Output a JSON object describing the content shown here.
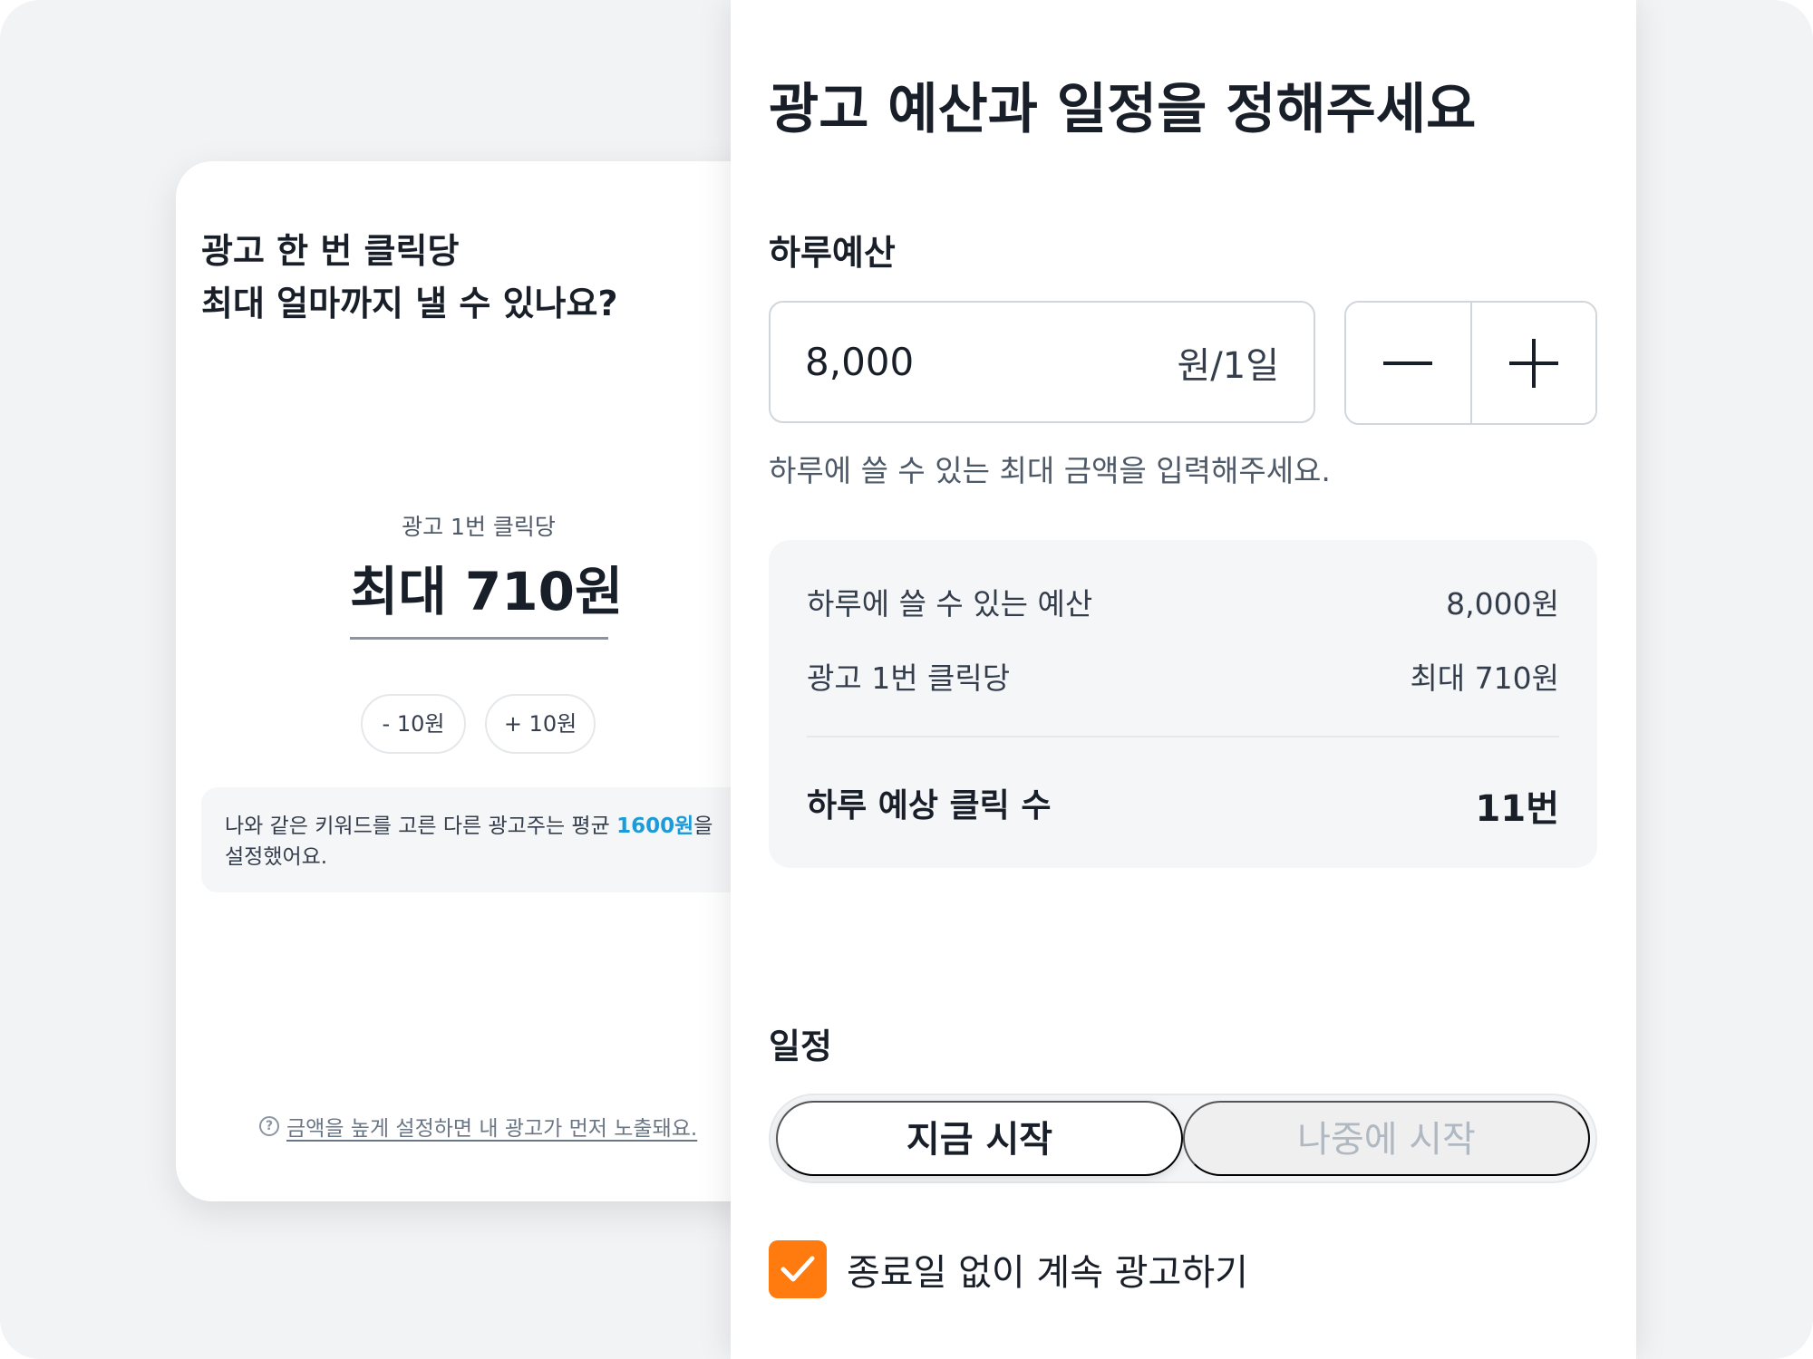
{
  "bid_card": {
    "title_line1": "광고 한 번 클릭당",
    "title_line2": "최대 얼마까지 낼 수 있나요?",
    "per_click_label": "광고 1번 클릭당",
    "max_amount": "최대 710원",
    "minus_button": "- 10원",
    "plus_button": "+ 10원",
    "info_prefix": "나와 같은 키워드를 고른 다른 광고주는 평균 ",
    "info_highlight": "1600원",
    "info_suffix": "을",
    "info_line2": "설정했어요.",
    "hint_icon": "question-circle-icon",
    "hint_text": "금액을 높게 설정하면 내 광고가 먼저 노출돼요."
  },
  "budget_panel": {
    "title": "광고 예산과 일정을 정해주세요",
    "daily_budget_label": "하루예산",
    "daily_budget_value": "8,000",
    "daily_budget_unit": "원/1일",
    "stepper_minus_icon": "minus-icon",
    "stepper_plus_icon": "plus-icon",
    "helper_text": "하루에 쓸 수 있는 최대 금액을 입력해주세요.",
    "summary": {
      "row1_label": "하루에 쓸 수 있는 예산",
      "row1_value": "8,000원",
      "row2_label": "광고 1번 클릭당",
      "row2_value": "최대 710원",
      "total_label": "하루 예상 클릭 수",
      "total_value": "11번"
    },
    "schedule_label": "일정",
    "schedule_options": [
      "지금 시작",
      "나중에 시작"
    ],
    "schedule_selected": "지금 시작",
    "no_end_date_label": "종료일 없이 계속 광고하기",
    "no_end_date_checked": true
  },
  "colors": {
    "accent_orange": "#ff7a0f",
    "highlight_blue": "#1b9bd8",
    "background": "#f2f3f5"
  }
}
